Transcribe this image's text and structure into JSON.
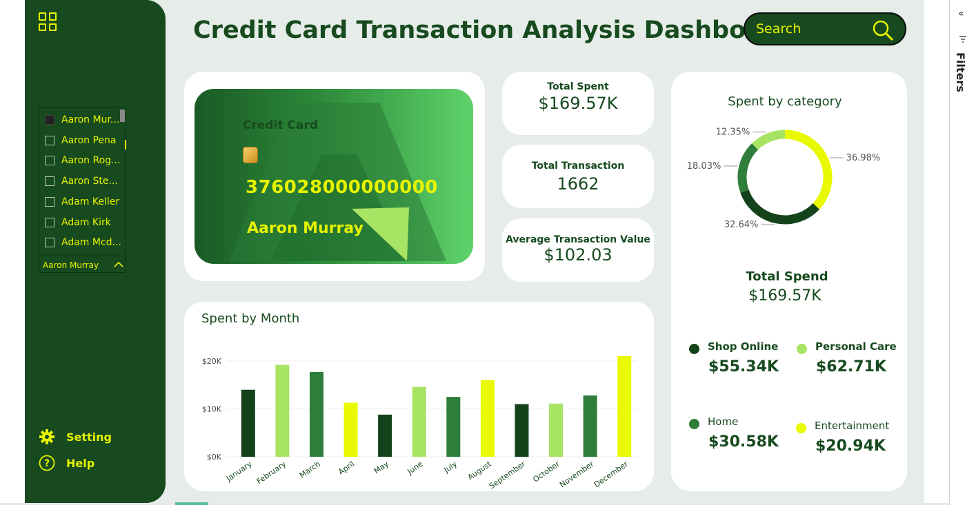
{
  "title": "Credit Card Transaction Analysis Dashboard",
  "search": {
    "placeholder": "Search"
  },
  "sidebar": {
    "slicer_items": [
      {
        "label": "Aaron Mur...",
        "checked": true
      },
      {
        "label": "Aaron Pena",
        "checked": false
      },
      {
        "label": "Aaron Rog...",
        "checked": false
      },
      {
        "label": "Aaron Ste...",
        "checked": false
      },
      {
        "label": "Adam Keller",
        "checked": false
      },
      {
        "label": "Adam Kirk",
        "checked": false
      },
      {
        "label": "Adam Mcd...",
        "checked": false
      }
    ],
    "slicer_selected": "Aaron Murray",
    "setting_label": "Setting",
    "help_label": "Help"
  },
  "card": {
    "label": "Credit Card",
    "number": "376028000000000",
    "holder": "Aaron Murray"
  },
  "kpis": [
    {
      "label": "Total Spent",
      "value": "$169.57K"
    },
    {
      "label": "Total Transaction",
      "value": "1662"
    },
    {
      "label": "Average Transaction Value",
      "value": "$102.03"
    }
  ],
  "category_panel": {
    "title": "Spent by category",
    "total_label": "Total Spend",
    "total_value": "$169.57K",
    "legend": [
      {
        "name": "Shop Online",
        "value": "$55.34K",
        "color": "#14421b"
      },
      {
        "name": "Personal Care",
        "value": "$62.71K",
        "color": "#a8e463"
      },
      {
        "name": "Home",
        "value": "$30.58K",
        "color": "#2f7d3a"
      },
      {
        "name": "Entertainment",
        "value": "$20.94K",
        "color": "#e9f900"
      }
    ]
  },
  "filters_label": "Filters",
  "chart_data": [
    {
      "type": "bar",
      "title": "Spent by Month",
      "categories": [
        "January",
        "February",
        "March",
        "April",
        "May",
        "June",
        "July",
        "August",
        "September",
        "October",
        "November",
        "December"
      ],
      "values": [
        14000,
        19200,
        17700,
        11300,
        8800,
        14600,
        12500,
        16000,
        11000,
        11100,
        12800,
        21000
      ],
      "colors": [
        "#14421b",
        "#a8e463",
        "#2f7d3a",
        "#e9f900",
        "#14421b",
        "#a8e463",
        "#2f7d3a",
        "#e9f900",
        "#14421b",
        "#a8e463",
        "#2f7d3a",
        "#e9f900"
      ],
      "yticks": [
        "$0K",
        "$10K",
        "$20K"
      ],
      "ylim": [
        0,
        20000
      ],
      "xlabel": "",
      "ylabel": "",
      "grid": true
    },
    {
      "type": "pie",
      "title": "Spent by category",
      "series": [
        {
          "name": "Entertainment",
          "percent_label": "36.98%",
          "color": "#e9f900"
        },
        {
          "name": "Shop Online",
          "percent_label": "32.64%",
          "color": "#14421b"
        },
        {
          "name": "Home",
          "percent_label": "18.03%",
          "color": "#2f7d3a"
        },
        {
          "name": "Personal Care",
          "percent_label": "12.35%",
          "color": "#a8e463"
        }
      ],
      "values": [
        36.98,
        32.64,
        18.03,
        12.35
      ]
    }
  ]
}
